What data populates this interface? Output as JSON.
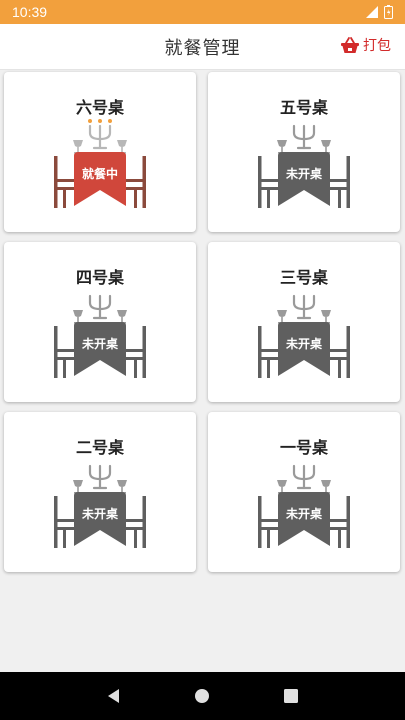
{
  "status_bar": {
    "time": "10:39"
  },
  "app_bar": {
    "title": "就餐管理",
    "pack_label": "打包"
  },
  "colors": {
    "accent": "#d22b2b",
    "status_bar": "#f2a03d",
    "occupied_cloth": "#d0473b",
    "occupied_chair": "#8b4a3c",
    "idle": "#5f5f5f",
    "idle_light": "#9a9a9a",
    "candle": "#f2a03d"
  },
  "tables": [
    {
      "name": "六号桌",
      "status": "就餐中",
      "occupied": true
    },
    {
      "name": "五号桌",
      "status": "未开桌",
      "occupied": false
    },
    {
      "name": "四号桌",
      "status": "未开桌",
      "occupied": false
    },
    {
      "name": "三号桌",
      "status": "未开桌",
      "occupied": false
    },
    {
      "name": "二号桌",
      "status": "未开桌",
      "occupied": false
    },
    {
      "name": "一号桌",
      "status": "未开桌",
      "occupied": false
    }
  ]
}
